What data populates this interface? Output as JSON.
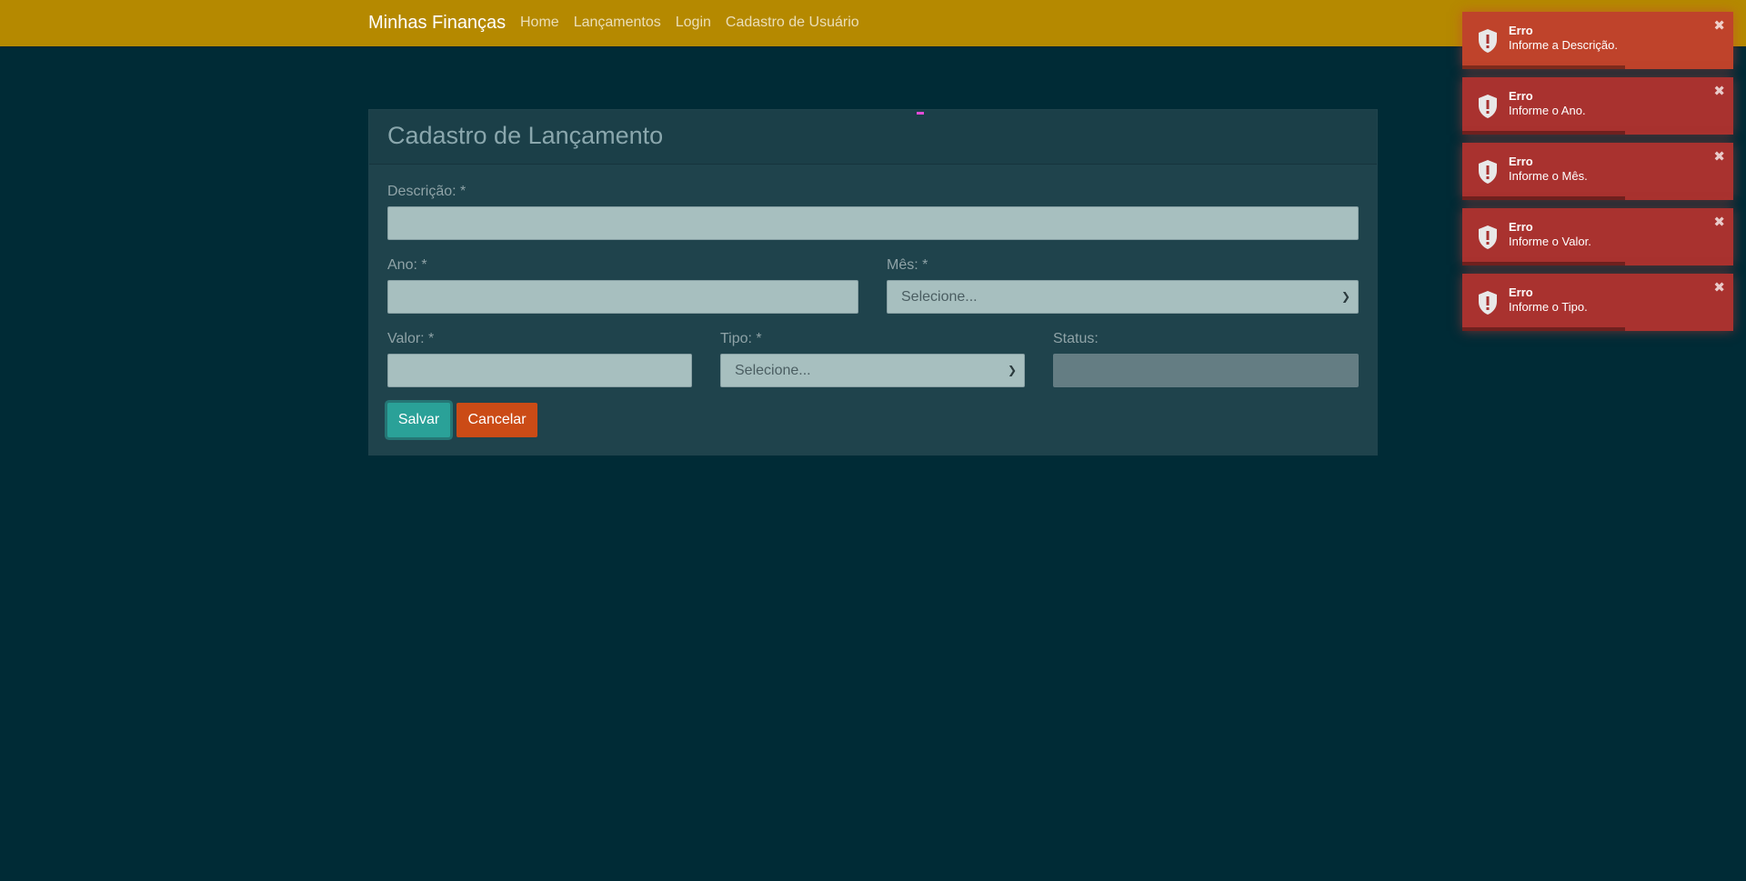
{
  "navbar": {
    "brand": "Minhas Finanças",
    "links": [
      "Home",
      "Lançamentos",
      "Login",
      "Cadastro de Usuário"
    ],
    "color": "#b58900"
  },
  "form": {
    "title": "Cadastro de Lançamento",
    "descricao": {
      "label": "Descrição: *",
      "value": ""
    },
    "ano": {
      "label": "Ano: *",
      "value": ""
    },
    "mes": {
      "label": "Mês: *",
      "selected": "Selecione..."
    },
    "valor": {
      "label": "Valor: *",
      "value": ""
    },
    "tipo": {
      "label": "Tipo: *",
      "selected": "Selecione..."
    },
    "status": {
      "label": "Status:",
      "value": ""
    },
    "save_label": "Salvar",
    "cancel_label": "Cancelar"
  },
  "toasts": [
    {
      "title": "Erro",
      "message": "Informe a Descrição.",
      "progress": 0.6
    },
    {
      "title": "Erro",
      "message": "Informe o Ano.",
      "progress": 0.6
    },
    {
      "title": "Erro",
      "message": "Informe o Mês.",
      "progress": 0.6
    },
    {
      "title": "Erro",
      "message": "Informe o Valor.",
      "progress": 0.6
    },
    {
      "title": "Erro",
      "message": "Informe o Tipo.",
      "progress": 0.6
    }
  ],
  "colors": {
    "background": "#002b36",
    "toast_error": "#a9322f",
    "save": "#2aa198",
    "cancel": "#cb4b16"
  }
}
